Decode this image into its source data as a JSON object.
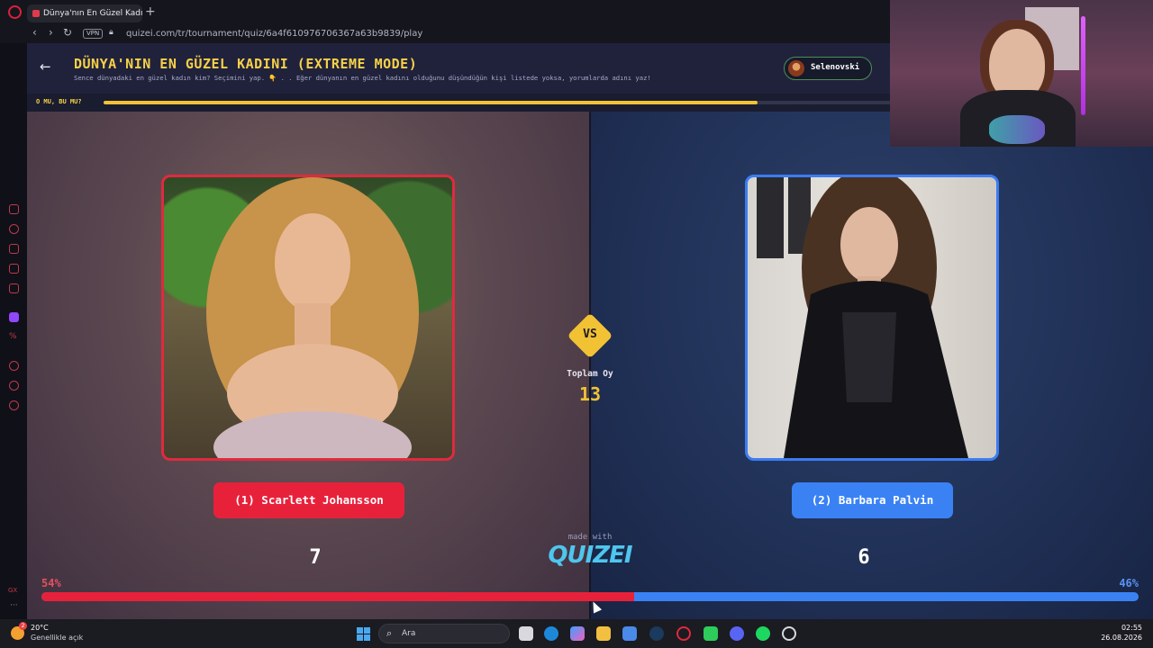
{
  "browser": {
    "tab_title": "Dünya'nın En Güzel Kadını",
    "tab_close": "×",
    "new_tab": "+",
    "vpn_label": "VPN",
    "url": "quizei.com/tr/tournament/quiz/6a4f610976706367a63b9839/play"
  },
  "header": {
    "back_icon": "arrow-left-icon",
    "title": "DÜNYA'NIN EN GÜZEL KADINI (EXTREME MODE)",
    "subtitle": "Sence dünyadaki en güzel kadın kim? Seçimini yap. 👇 . . Eğer dünyanın en güzel kadını olduğunu düşündüğün kişi listede yoksa, yorumlarda adını yaz!",
    "user_name": "Selenovski"
  },
  "progress": {
    "label": "O MU, BU MU?",
    "fraction": 0.83
  },
  "match": {
    "vs": "VS",
    "total_label": "Toplam Oy",
    "total_value": "13",
    "left": {
      "name": "(1) Scarlett Johansson",
      "votes": "7",
      "percent": "54%",
      "share": 0.54,
      "color": "#e8213b"
    },
    "right": {
      "name": "(2) Barbara Palvin",
      "votes": "6",
      "percent": "46%",
      "share": 0.46,
      "color": "#3a82f4"
    }
  },
  "branding": {
    "made_with": "made with",
    "brand": "QUIZEI"
  },
  "taskbar": {
    "weather_temp": "20°C",
    "weather_desc": "Genellikle açık",
    "weather_badge": "2",
    "search_placeholder": "Ara",
    "time": "02:55",
    "date": "26.08.2026"
  },
  "colors": {
    "accent_yellow": "#f2c235",
    "red": "#e8213b",
    "blue": "#3a82f4"
  }
}
